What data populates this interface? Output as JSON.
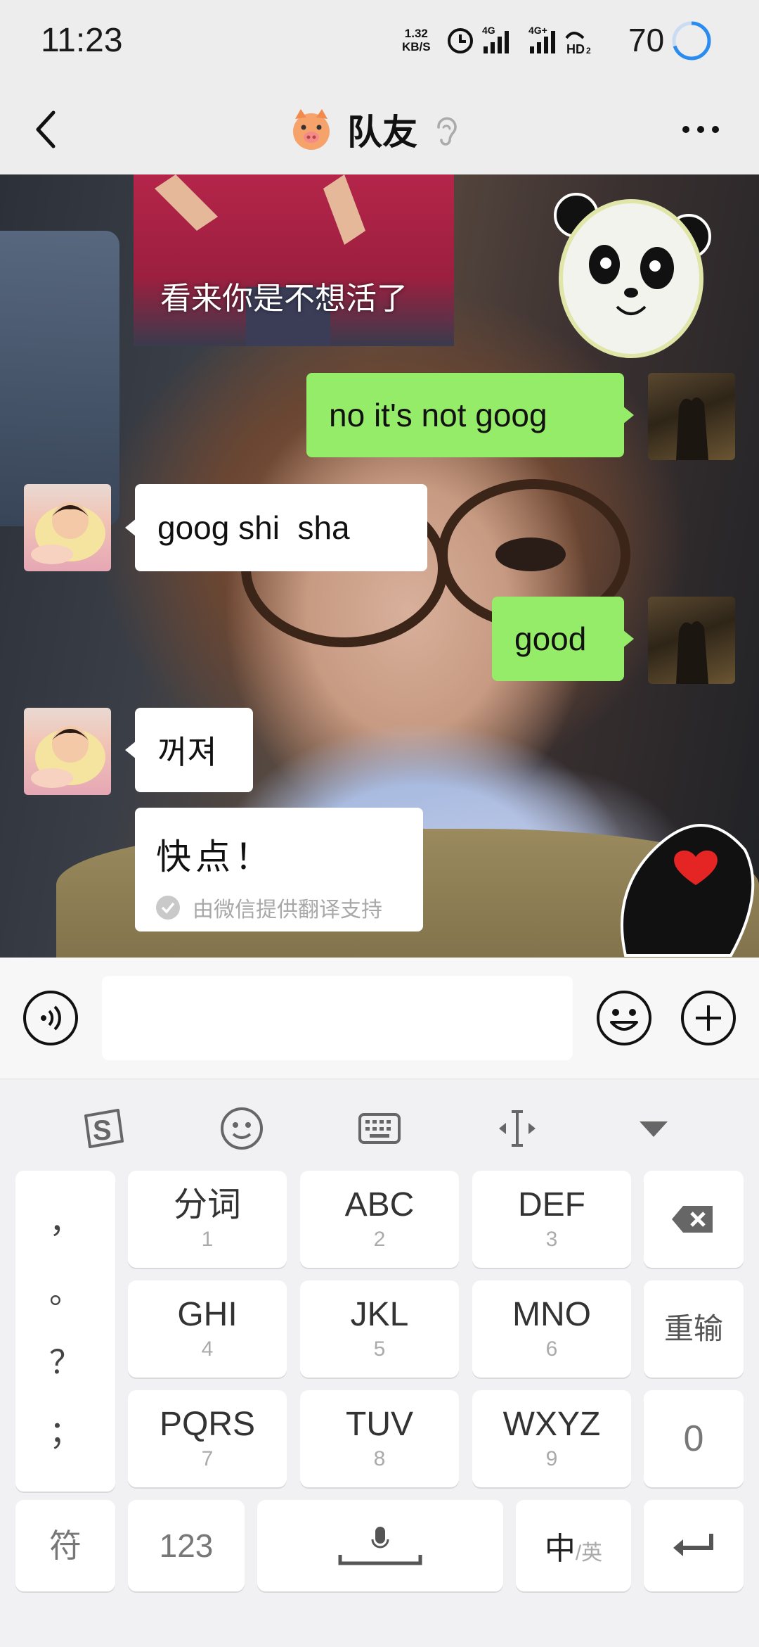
{
  "status_bar": {
    "time": "11:23",
    "net_speed_value": "1.32",
    "net_speed_unit": "KB/S",
    "signal1_label": "4G",
    "signal2_label": "4G+",
    "hd_label": "HD",
    "battery": "70"
  },
  "nav": {
    "title": "队友",
    "title_icon": "pig-face-icon",
    "back_icon": "back-arrow-icon",
    "more_icon": "more-dots-icon",
    "earpiece_icon": "earpiece-mode-icon"
  },
  "chat": {
    "sticker_caption": "看来你是不想活了",
    "messages": [
      {
        "side": "right",
        "text": "no it's not goog"
      },
      {
        "side": "left",
        "text": "goog shi  sha"
      },
      {
        "side": "right",
        "text": "good"
      },
      {
        "side": "left",
        "text": "꺼져"
      }
    ],
    "translation": {
      "text": "快点！",
      "note": "由微信提供翻译支持"
    }
  },
  "input_bar": {
    "voice_icon": "voice-input-icon",
    "emoji_icon": "emoji-icon",
    "plus_icon": "plus-icon",
    "value": ""
  },
  "keyboard": {
    "toolbar": [
      "sogou-logo-icon",
      "emoji-face-icon",
      "keyboard-icon",
      "cursor-move-icon",
      "collapse-triangle-icon"
    ],
    "punctuation": [
      "，",
      "。",
      "？",
      "；"
    ],
    "keys": [
      {
        "label": "分词",
        "num": "1"
      },
      {
        "label": "ABC",
        "num": "2"
      },
      {
        "label": "DEF",
        "num": "3"
      },
      {
        "label": "GHI",
        "num": "4"
      },
      {
        "label": "JKL",
        "num": "5"
      },
      {
        "label": "MNO",
        "num": "6"
      },
      {
        "label": "PQRS",
        "num": "7"
      },
      {
        "label": "TUV",
        "num": "8"
      },
      {
        "label": "WXYZ",
        "num": "9"
      }
    ],
    "reinput": "重输",
    "zero": "0",
    "symbols": "符",
    "numbers": "123",
    "lang_main": "中",
    "lang_sub": "/英",
    "space_icon": "microphone-space-icon",
    "enter_icon": "enter-arrow-icon",
    "delete_icon": "backspace-icon"
  },
  "colors": {
    "accent_green_bubble": "#95ec69",
    "battery_ring": "#2b8cf0"
  }
}
